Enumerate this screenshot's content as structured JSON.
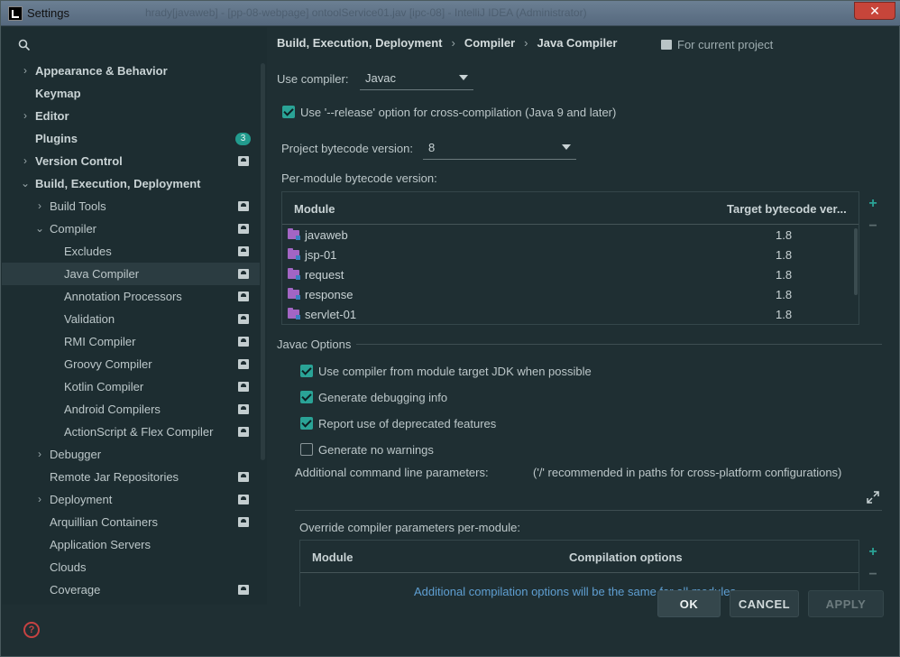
{
  "window": {
    "title": "Settings",
    "ghost_title": "hrady[javaweb] - [pp-08-webpage] ontoolService01.jav [ipc-08] - IntelliJ IDEA (Administrator)",
    "close_label": "✕"
  },
  "search": {
    "icon": "search-icon",
    "value": ""
  },
  "sidebar": {
    "items": [
      {
        "label": "Appearance & Behavior",
        "bold": true,
        "chevron": "›",
        "indent": 0,
        "project": false
      },
      {
        "label": "Keymap",
        "bold": true,
        "chevron": "",
        "indent": 0,
        "project": false
      },
      {
        "label": "Editor",
        "bold": true,
        "chevron": "›",
        "indent": 0,
        "project": false
      },
      {
        "label": "Plugins",
        "bold": true,
        "chevron": "",
        "indent": 0,
        "project": false,
        "badge": "3"
      },
      {
        "label": "Version Control",
        "bold": true,
        "chevron": "›",
        "indent": 0,
        "project": true
      },
      {
        "label": "Build, Execution, Deployment",
        "bold": true,
        "chevron": "⌄",
        "indent": 0,
        "project": false
      },
      {
        "label": "Build Tools",
        "bold": false,
        "chevron": "›",
        "indent": 1,
        "project": true
      },
      {
        "label": "Compiler",
        "bold": false,
        "chevron": "⌄",
        "indent": 1,
        "project": true
      },
      {
        "label": "Excludes",
        "bold": false,
        "chevron": "",
        "indent": 2,
        "project": true
      },
      {
        "label": "Java Compiler",
        "bold": false,
        "chevron": "",
        "indent": 2,
        "project": true,
        "selected": true
      },
      {
        "label": "Annotation Processors",
        "bold": false,
        "chevron": "",
        "indent": 2,
        "project": true
      },
      {
        "label": "Validation",
        "bold": false,
        "chevron": "",
        "indent": 2,
        "project": true
      },
      {
        "label": "RMI Compiler",
        "bold": false,
        "chevron": "",
        "indent": 2,
        "project": true
      },
      {
        "label": "Groovy Compiler",
        "bold": false,
        "chevron": "",
        "indent": 2,
        "project": true
      },
      {
        "label": "Kotlin Compiler",
        "bold": false,
        "chevron": "",
        "indent": 2,
        "project": true
      },
      {
        "label": "Android Compilers",
        "bold": false,
        "chevron": "",
        "indent": 2,
        "project": true
      },
      {
        "label": "ActionScript & Flex Compiler",
        "bold": false,
        "chevron": "",
        "indent": 2,
        "project": true
      },
      {
        "label": "Debugger",
        "bold": false,
        "chevron": "›",
        "indent": 1,
        "project": false
      },
      {
        "label": "Remote Jar Repositories",
        "bold": false,
        "chevron": "",
        "indent": 1,
        "project": true
      },
      {
        "label": "Deployment",
        "bold": false,
        "chevron": "›",
        "indent": 1,
        "project": true
      },
      {
        "label": "Arquillian Containers",
        "bold": false,
        "chevron": "",
        "indent": 1,
        "project": true
      },
      {
        "label": "Application Servers",
        "bold": false,
        "chevron": "",
        "indent": 1,
        "project": false
      },
      {
        "label": "Clouds",
        "bold": false,
        "chevron": "",
        "indent": 1,
        "project": false
      },
      {
        "label": "Coverage",
        "bold": false,
        "chevron": "",
        "indent": 1,
        "project": true
      }
    ]
  },
  "breadcrumb": [
    "Build, Execution, Deployment",
    "Compiler",
    "Java Compiler"
  ],
  "for_project": "For current project",
  "use_compiler": {
    "label": "Use compiler:",
    "value": "Javac"
  },
  "release_option": {
    "label": "Use '--release' option for cross-compilation (Java 9 and later)",
    "checked": true
  },
  "project_bytecode": {
    "label": "Project bytecode version:",
    "value": "8"
  },
  "per_module": {
    "label": "Per-module bytecode version:",
    "headers": [
      "Module",
      "Target bytecode ver..."
    ],
    "rows": [
      {
        "module": "javaweb",
        "version": "1.8"
      },
      {
        "module": "jsp-01",
        "version": "1.8"
      },
      {
        "module": "request",
        "version": "1.8"
      },
      {
        "module": "response",
        "version": "1.8"
      },
      {
        "module": "servlet-01",
        "version": "1.8"
      }
    ],
    "add": "+",
    "remove": "−"
  },
  "javac_options": {
    "title": "Javac Options",
    "checks": [
      {
        "label": "Use compiler from module target JDK when possible",
        "checked": true
      },
      {
        "label": "Generate debugging info",
        "checked": true
      },
      {
        "label": "Report use of deprecated features",
        "checked": true
      },
      {
        "label": "Generate no warnings",
        "checked": false
      }
    ],
    "additional_label": "Additional command line parameters:",
    "additional_hint": "('/' recommended in paths for cross-platform configurations)",
    "additional_value": ""
  },
  "override": {
    "label": "Override compiler parameters per-module:",
    "headers": [
      "Module",
      "Compilation options"
    ],
    "empty_text": "Additional compilation options will be the same for all modules",
    "add": "+",
    "remove": "−"
  },
  "buttons": {
    "ok": "OK",
    "cancel": "CANCEL",
    "apply": "APPLY"
  },
  "help": "?",
  "colors": {
    "accent": "#2aa396",
    "folder": "#a365c4",
    "background": "#1f2f33"
  }
}
